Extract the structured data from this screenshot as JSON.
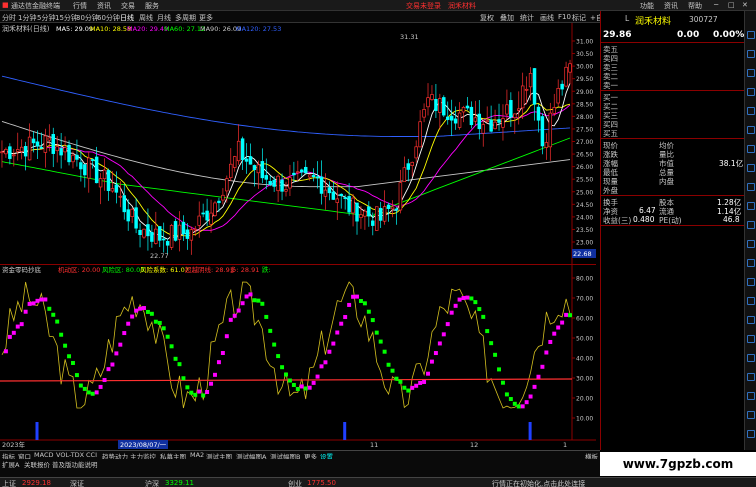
{
  "titlebar": {
    "app": "通达信金融终端",
    "menus": [
      "行情",
      "资讯",
      "交易",
      "服务"
    ],
    "center_a": "交易未登录",
    "center_b": "润禾材料",
    "right": [
      "功能",
      "资讯",
      "帮助"
    ]
  },
  "toolbar": {
    "periods": [
      "分时",
      "1分钟",
      "5分钟",
      "15分钟",
      "30分钟",
      "60分钟",
      "日线",
      "周线",
      "月线",
      "多周期",
      "更多"
    ],
    "right": [
      "复权",
      "叠加",
      "统计",
      "画线",
      "F10",
      "标记",
      "+自选",
      "返回"
    ]
  },
  "main_chart": {
    "header": "润禾材料(日线)",
    "ma": [
      {
        "label": "MA5: 29.09",
        "color": "#ffffff"
      },
      {
        "label": "MA10: 28.58",
        "color": "#ffff00"
      },
      {
        "label": "MA20: 29.49",
        "color": "#ff00ff"
      },
      {
        "label": "MA60: 27.12",
        "color": "#00ff00"
      },
      {
        "label": "MA90: 26.09",
        "color": "#c8c8c8"
      },
      {
        "label": "MA120: 27.53",
        "color": "#3060ff"
      }
    ],
    "high_label": "31.31",
    "low_label": "22.77",
    "price_ticks": [
      "31.00",
      "30.50",
      "30.00",
      "29.50",
      "29.00",
      "28.50",
      "28.00",
      "27.50",
      "27.00",
      "26.50",
      "26.00",
      "25.50",
      "25.00",
      "24.50",
      "24.00",
      "23.50",
      "23.00"
    ],
    "current_price": "22.68"
  },
  "indicator": {
    "name": "资金零码抄底",
    "params": [
      {
        "label": "机动区: 20.00",
        "color": "#ff3030"
      },
      {
        "label": "风险区: 80.00",
        "color": "#00ff00"
      },
      {
        "label": "风险系数: 61.07",
        "color": "#ffff00"
      },
      {
        "label": "超越阴线: 28.91",
        "color": "#ff3030"
      },
      {
        "label": "多: 28.91",
        "color": "#ff3030"
      },
      {
        "label": "跌: ",
        "color": "#00ff00"
      }
    ],
    "ticks": [
      "80.00",
      "70.00",
      "60.00",
      "50.00",
      "40.00",
      "30.00",
      "20.00",
      "10.00"
    ]
  },
  "date_axis": {
    "start": "2023年",
    "cursor": "2023/08/07/一",
    "labels": [
      "11",
      "12",
      "1"
    ]
  },
  "tabs": {
    "row1": [
      "指标",
      "窗口",
      "MACD",
      "VOL-TDX",
      "CCI",
      "趋势动力",
      "主力监控",
      "私募主图",
      "MA2",
      "测试主图",
      "测试幅图A",
      "测试幅图B",
      "更多",
      "设置"
    ],
    "row1_right": "横板",
    "row2": [
      "扩展A",
      "关联报价",
      "普及版功能说明"
    ]
  },
  "rpanel": {
    "name": "润禾材料",
    "code": "300727",
    "price": "29.86",
    "change": "0.00",
    "pct": "0.00%",
    "order_book_sell": [
      "卖五",
      "卖四",
      "卖三",
      "卖二",
      "卖一"
    ],
    "order_book_buy": [
      "买一",
      "买二",
      "买三",
      "买四",
      "买五"
    ],
    "stats": [
      {
        "k": "现价",
        "v": "",
        "k2": "均价",
        "v2": ""
      },
      {
        "k": "涨跌",
        "v": "",
        "k2": "量比",
        "v2": ""
      },
      {
        "k": "涨幅",
        "v": "",
        "k2": "市值",
        "v2": "38.1亿"
      },
      {
        "k": "最低",
        "v": "",
        "k2": "总量",
        "v2": ""
      },
      {
        "k": "现量",
        "v": "",
        "k2": "内盘",
        "v2": ""
      },
      {
        "k": "外盘",
        "v": "",
        "k2": "",
        "v2": ""
      }
    ],
    "fund": [
      {
        "k": "换手",
        "v": "",
        "k2": "股本",
        "v2": "1.28亿"
      },
      {
        "k": "净资",
        "v": "6.47",
        "k2": "流通",
        "v2": "1.14亿"
      },
      {
        "k": "收益(三)",
        "v": "0.480",
        "k2": "PE(动)",
        "v2": "46.8"
      }
    ]
  },
  "statusbar": {
    "items": [
      {
        "label": "上证",
        "value": "2929.18",
        "color": "#ff3030"
      },
      {
        "label": "深证",
        "value": "",
        "color": "#ff3030"
      },
      {
        "label": "沪深",
        "value": "3329.11",
        "color": "#00ff00"
      },
      {
        "label": "创业",
        "value": "1775.50",
        "color": "#ff3030"
      }
    ],
    "message": "行情正在初始化,点击此处连接",
    "watermark": "www.7gpzb.com"
  },
  "colors": {
    "up": "#ff3030",
    "down": "#00ffff",
    "text": "#c8c8c8",
    "axis": "#8b0000"
  }
}
